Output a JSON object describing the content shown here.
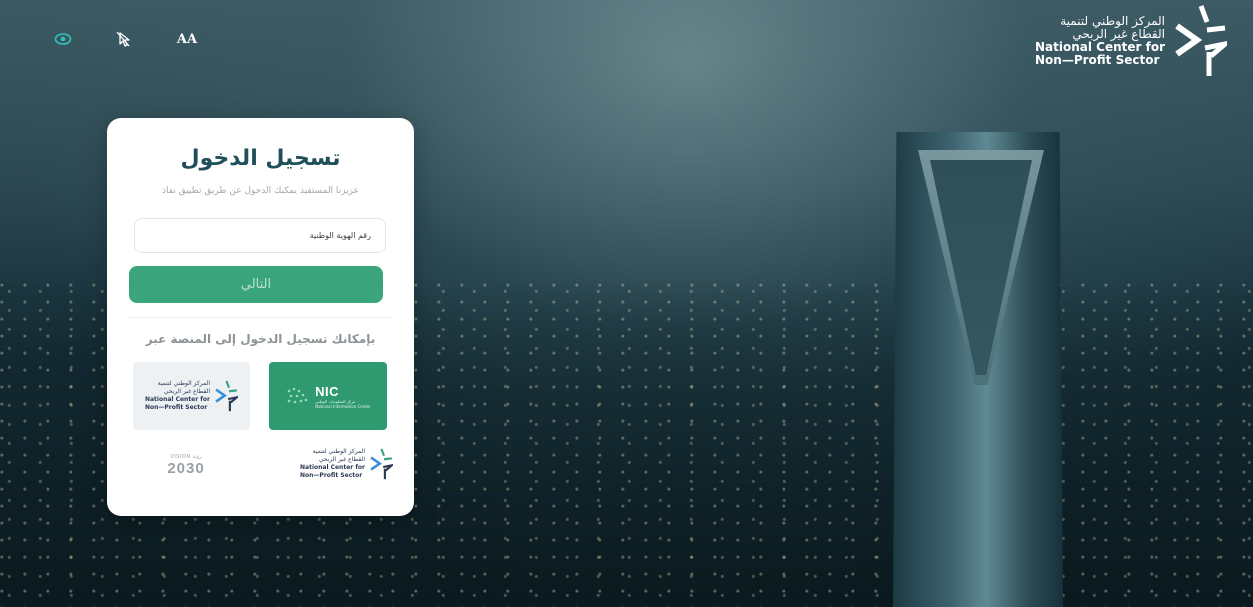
{
  "header": {
    "brand_ar_line1": "المركز الوطني لتنمية",
    "brand_ar_line2": "القطاع غير الربحي",
    "brand_en_line1": "National Center for",
    "brand_en_line2": "Non—Profit Sector",
    "tools": [
      {
        "icon": "eye-icon"
      },
      {
        "icon": "cursor-off-icon"
      },
      {
        "icon": "font-size-icon",
        "label": "AA"
      }
    ]
  },
  "login": {
    "title": "تسجيل الدخول",
    "subtitle": "عزيزنا المستفيد يمكنك الدخول عن طريق تطبيق نفاذ",
    "id_placeholder": "رقم الهوية الوطنية",
    "id_value": "",
    "next_label": "التالي",
    "alt_label": "بإمكانك تسجيل الدخول إلى المنصة عبر"
  },
  "providers": {
    "nic": {
      "name": "NIC",
      "sub_ar": "مركز المعلومات الوطني",
      "sub_en": "National Information Center"
    },
    "ncnp": {
      "ar_line1": "المركز الوطني لتنمية",
      "ar_line2": "القطاع غير الربحي",
      "en_line1": "National Center for",
      "en_line2": "Non—Profit Sector"
    }
  },
  "footer": {
    "vision_top": "VISION رؤية",
    "vision_year": "2030",
    "ar_line1": "المركز الوطني لتنمية",
    "ar_line2": "القطاع غير الربحي",
    "en_line1": "National Center for",
    "en_line2": "Non—Profit Sector"
  },
  "colors": {
    "accent": "#3aa57c",
    "title": "#1f4f5a",
    "icon_teal": "#2fc3b8",
    "brand_navy": "#2b3a55",
    "brand_blue": "#3b8fd9",
    "brand_green": "#3aa57c"
  }
}
